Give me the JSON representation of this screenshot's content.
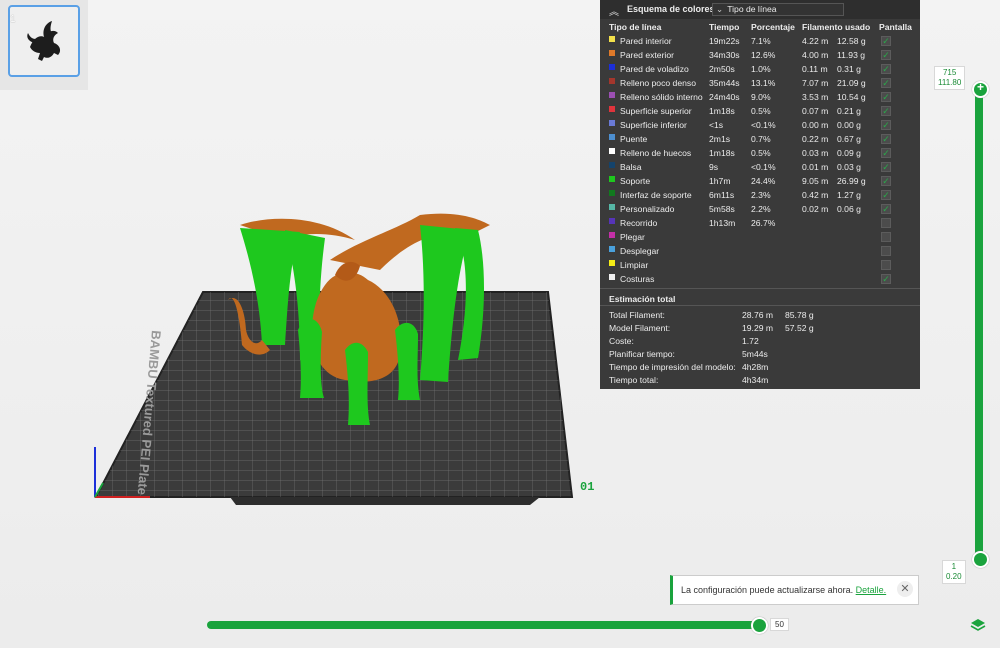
{
  "plate_thumb": {
    "number": "1"
  },
  "bed": {
    "brand_text": "BAMBU Textured PEI Plate",
    "plate_index": "01"
  },
  "legend": {
    "title": "Esquema de colores",
    "view_mode": "Tipo de línea",
    "columns": {
      "type": "Tipo de línea",
      "time": "Tiempo",
      "percent": "Porcentaje",
      "filament": "Filamento usado",
      "display": "Pantalla"
    },
    "rows": [
      {
        "label": "Pared interior",
        "time": "19m22s",
        "pct": "7.1%",
        "len": "4.22 m",
        "wt": "12.58 g",
        "color": "#f3e14b",
        "shown": true
      },
      {
        "label": "Pared exterior",
        "time": "34m30s",
        "pct": "12.6%",
        "len": "4.00 m",
        "wt": "11.93 g",
        "color": "#e07a2a",
        "shown": true
      },
      {
        "label": "Pared de voladizo",
        "time": "2m50s",
        "pct": "1.0%",
        "len": "0.11 m",
        "wt": "0.31 g",
        "color": "#1c2fd9",
        "shown": true
      },
      {
        "label": "Relleno poco denso",
        "time": "35m44s",
        "pct": "13.1%",
        "len": "7.07 m",
        "wt": "21.09 g",
        "color": "#a3362c",
        "shown": true
      },
      {
        "label": "Relleno sólido interno",
        "time": "24m40s",
        "pct": "9.0%",
        "len": "3.53 m",
        "wt": "10.54 g",
        "color": "#9b4fb3",
        "shown": true
      },
      {
        "label": "Superficie superior",
        "time": "1m18s",
        "pct": "0.5%",
        "len": "0.07 m",
        "wt": "0.21 g",
        "color": "#e0343c",
        "shown": true
      },
      {
        "label": "Superficie inferior",
        "time": "<1s",
        "pct": "<0.1%",
        "len": "0.00 m",
        "wt": "0.00 g",
        "color": "#6a7ad6",
        "shown": true
      },
      {
        "label": "Puente",
        "time": "2m1s",
        "pct": "0.7%",
        "len": "0.22 m",
        "wt": "0.67 g",
        "color": "#4d8fd0",
        "shown": true
      },
      {
        "label": "Relleno de huecos",
        "time": "1m18s",
        "pct": "0.5%",
        "len": "0.03 m",
        "wt": "0.09 g",
        "color": "#ffffff",
        "shown": true
      },
      {
        "label": "Balsa",
        "time": "9s",
        "pct": "<0.1%",
        "len": "0.01 m",
        "wt": "0.03 g",
        "color": "#14436b",
        "shown": true
      },
      {
        "label": "Soporte",
        "time": "1h7m",
        "pct": "24.4%",
        "len": "9.05 m",
        "wt": "26.99 g",
        "color": "#1ec81e",
        "shown": true
      },
      {
        "label": "Interfaz de soporte",
        "time": "6m11s",
        "pct": "2.3%",
        "len": "0.42 m",
        "wt": "1.27 g",
        "color": "#117a1e",
        "shown": true
      },
      {
        "label": "Personalizado",
        "time": "5m58s",
        "pct": "2.2%",
        "len": "0.02 m",
        "wt": "0.06 g",
        "color": "#56b7a6",
        "shown": true
      },
      {
        "label": "Recorrido",
        "time": "1h13m",
        "pct": "26.7%",
        "len": "",
        "wt": "",
        "color": "#5634b8",
        "shown": false
      },
      {
        "label": "Plegar",
        "time": "",
        "pct": "",
        "len": "",
        "wt": "",
        "color": "#c42fa8",
        "shown": false
      },
      {
        "label": "Desplegar",
        "time": "",
        "pct": "",
        "len": "",
        "wt": "",
        "color": "#4aa1dc",
        "shown": false
      },
      {
        "label": "Limpiar",
        "time": "",
        "pct": "",
        "len": "",
        "wt": "",
        "color": "#f5ec17",
        "shown": false
      },
      {
        "label": "Costuras",
        "time": "",
        "pct": "",
        "len": "",
        "wt": "",
        "color": "#eeeeee",
        "shown": true
      }
    ],
    "estimate_title": "Estimación total",
    "estimates": [
      {
        "label": "Total Filament:",
        "v1": "28.76 m",
        "v2": "85.78 g"
      },
      {
        "label": "Model Filament:",
        "v1": "19.29 m",
        "v2": "57.52 g"
      },
      {
        "label": "Coste:",
        "v1": "1.72",
        "v2": ""
      },
      {
        "label": "Planificar tiempo:",
        "v1": "5m44s",
        "v2": ""
      },
      {
        "label": "Tiempo de impresión del modelo:",
        "v1": "4h28m",
        "v2": ""
      },
      {
        "label": "Tiempo total:",
        "v1": "4h34m",
        "v2": ""
      }
    ]
  },
  "layer_slider": {
    "top_layer": "715",
    "top_height": "111.80",
    "bottom_layer": "1",
    "bottom_height": "0.20",
    "top_fraction": 1.0,
    "bottom_fraction": 0.0
  },
  "move_slider": {
    "value": "50",
    "fraction": 0.99
  },
  "toast": {
    "message": "La configuración puede actualizarse ahora.",
    "link": "Detalle.",
    "close": "✕"
  },
  "icons": {
    "collapse": "chevron-up-icon",
    "dropdown": "chevron-down-icon",
    "close": "close-icon",
    "layers": "layers-icon"
  }
}
